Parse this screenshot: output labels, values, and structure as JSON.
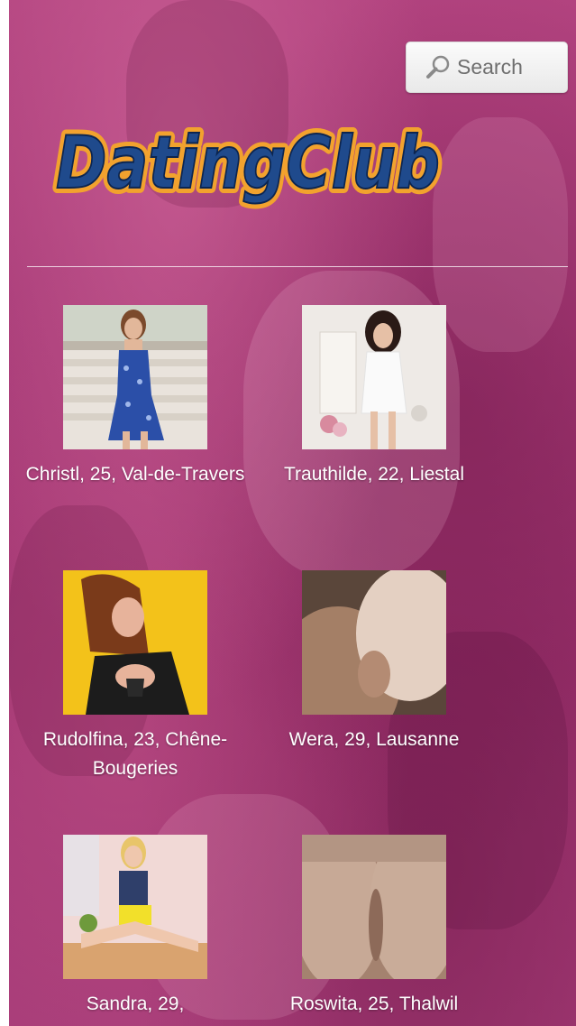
{
  "search": {
    "label": "Search",
    "icon": "search-icon"
  },
  "logo": {
    "text": "DatingClub",
    "fill_color": "#1f4a8c",
    "outline_color": "#f2a22e"
  },
  "colors": {
    "background": "#a63b78",
    "divider": "#ffffff",
    "caption_text": "#ffffff"
  },
  "profiles": [
    {
      "caption": "Christl, 25, Val-de-Travers"
    },
    {
      "caption": "Trauthilde, 22, Liestal"
    },
    {
      "caption": "Rudolfina, 23, Chêne-Bougeries"
    },
    {
      "caption": "Wera, 29, Lausanne"
    },
    {
      "caption": "Sandra, 29,"
    },
    {
      "caption": "Roswita, 25, Thalwil"
    }
  ]
}
